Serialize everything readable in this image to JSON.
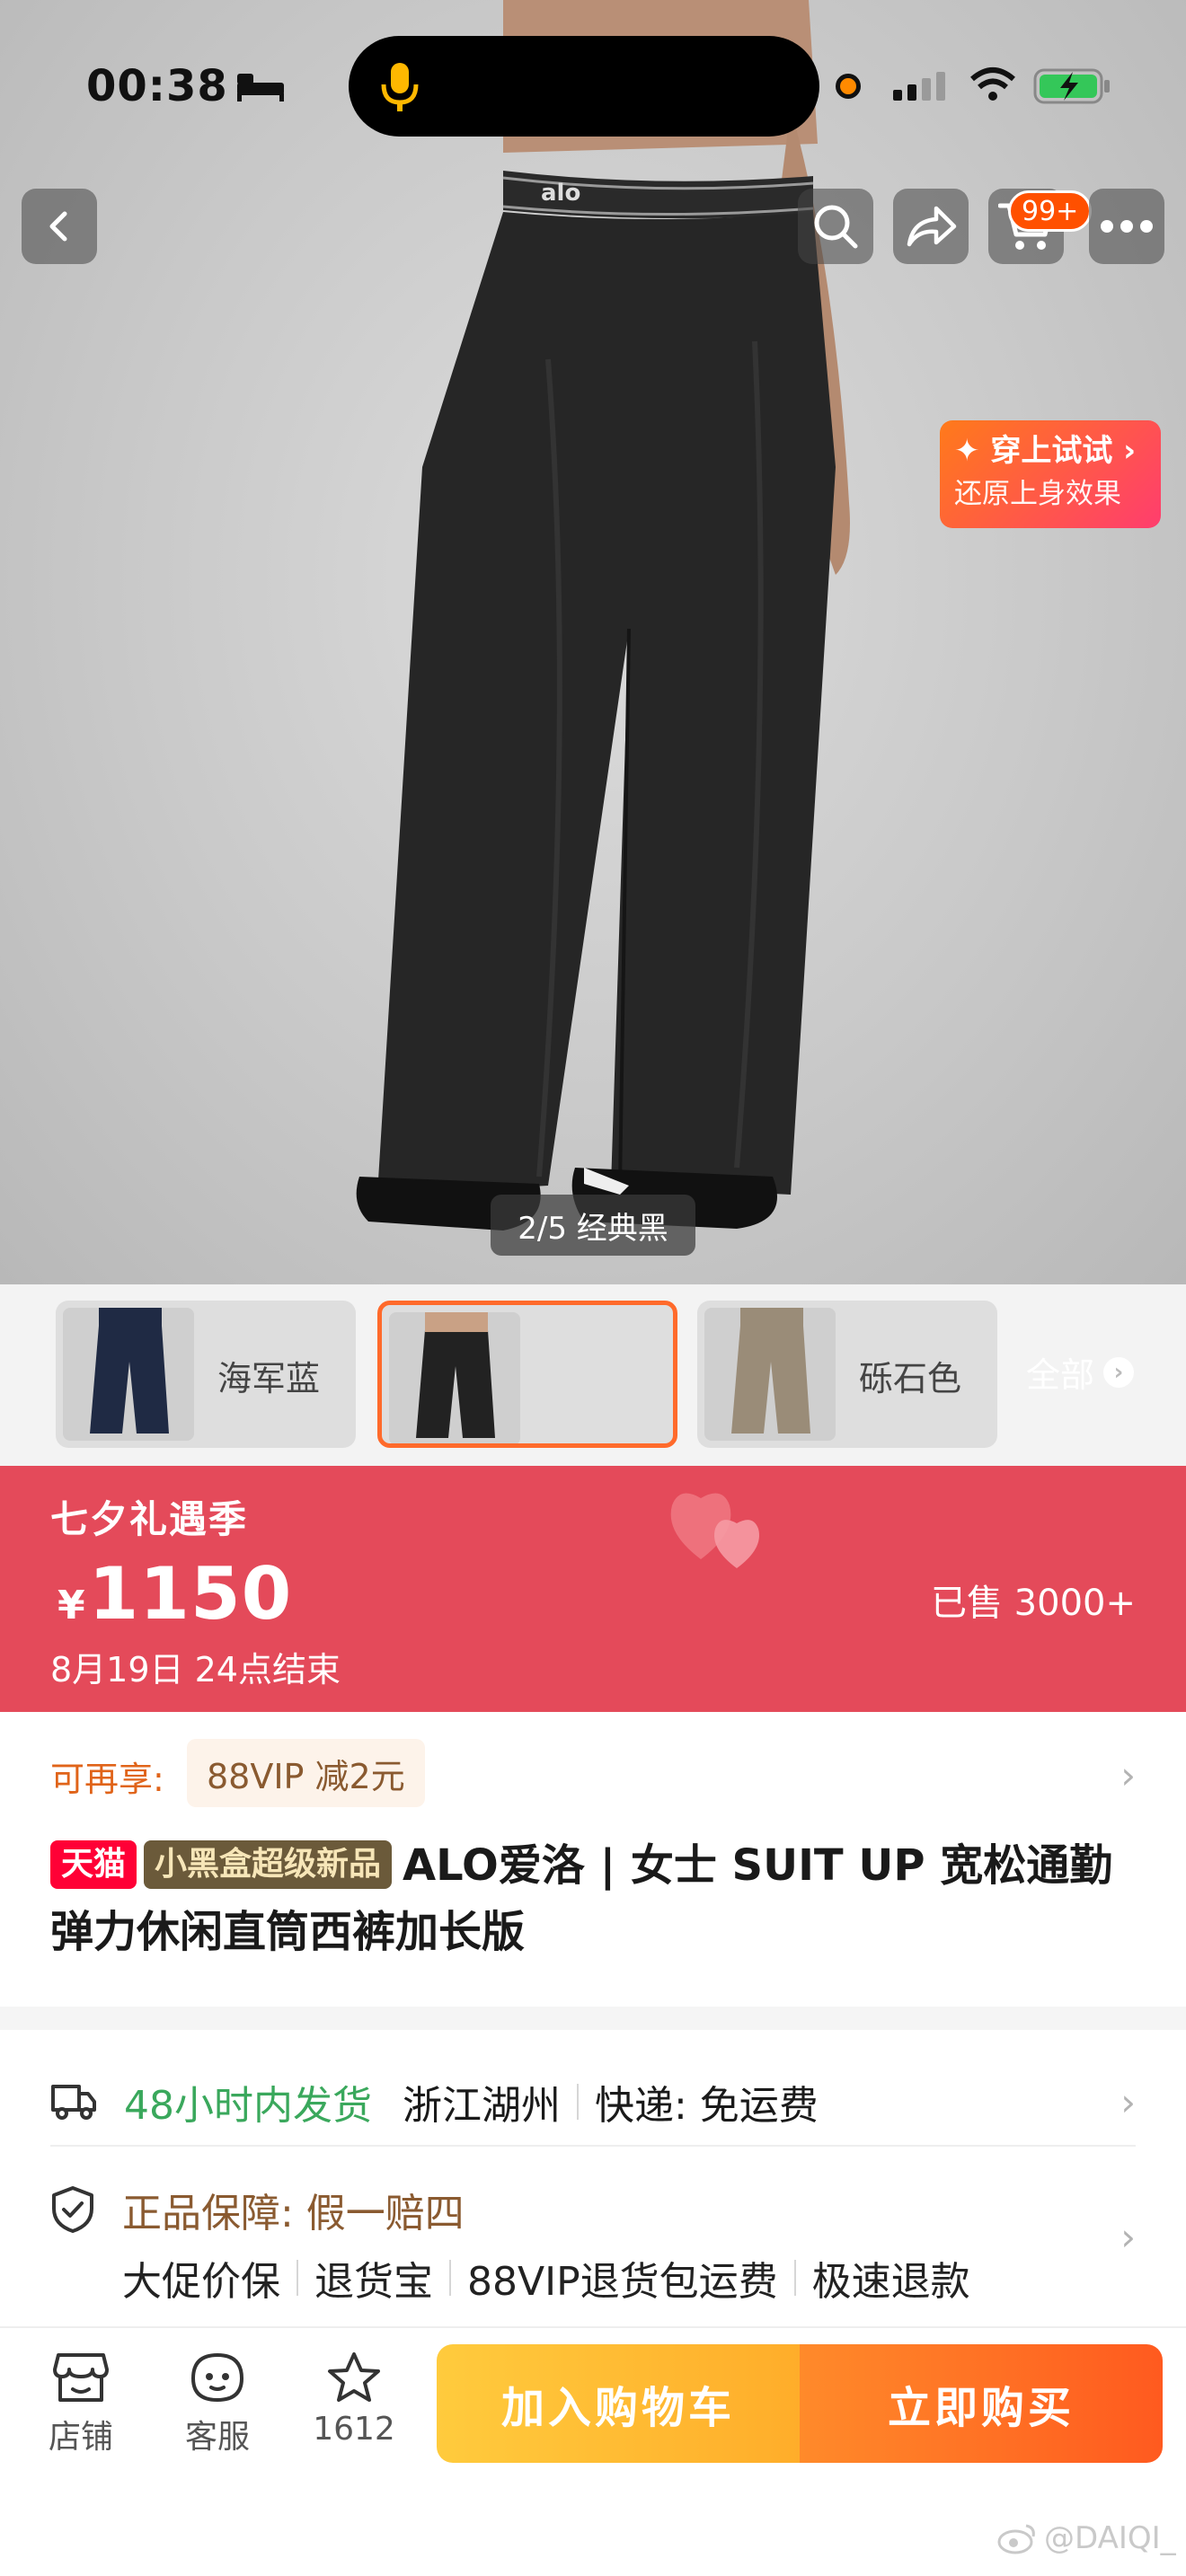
{
  "status_bar": {
    "time": "00:38"
  },
  "nav": {
    "cart_badge": "99+"
  },
  "hero": {
    "logo_text": "alo",
    "tryon_title": "✦ 穿上试试 ›",
    "tryon_subtitle": "还原上身效果",
    "image_counter": "2/5 经典黑"
  },
  "color_options": [
    {
      "label": "海军蓝",
      "selected": false
    },
    {
      "label": "",
      "selected": true
    },
    {
      "label": "砾石色",
      "selected": false
    }
  ],
  "all_label": "全部",
  "price_banner": {
    "promo_title": "七夕礼遇季",
    "currency": "¥",
    "price": "1150",
    "sold": "已售 3000+",
    "deadline": "8月19日 24点结束"
  },
  "vip": {
    "label": "可再享:",
    "chip": "88VIP 减2元"
  },
  "product": {
    "tag_tmall": "天猫",
    "tag_new": "小黑盒超级新品",
    "title": "ALO爱洛 | 女士 SUIT UP 宽松通勤弹力休闲直筒西裤加长版"
  },
  "shipping": {
    "speed": "48小时内发货",
    "origin": "浙江湖州",
    "delivery": "快递: 免运费"
  },
  "guarantee": {
    "title": "正品保障: 假一赔四",
    "items": [
      "大促价保",
      "退货宝",
      "88VIP退货包运费",
      "极速退款"
    ]
  },
  "bottom_bar": {
    "store": "店铺",
    "service": "客服",
    "favorites": "1612",
    "add_to_cart": "加入购物车",
    "buy_now": "立即购买"
  },
  "watermark": "@DAIQI_",
  "colors": {
    "accent": "#ff5000",
    "banner": "#e44a5a",
    "cart_yellow": "#ffb52e",
    "buy_orange": "#ff6a22"
  }
}
